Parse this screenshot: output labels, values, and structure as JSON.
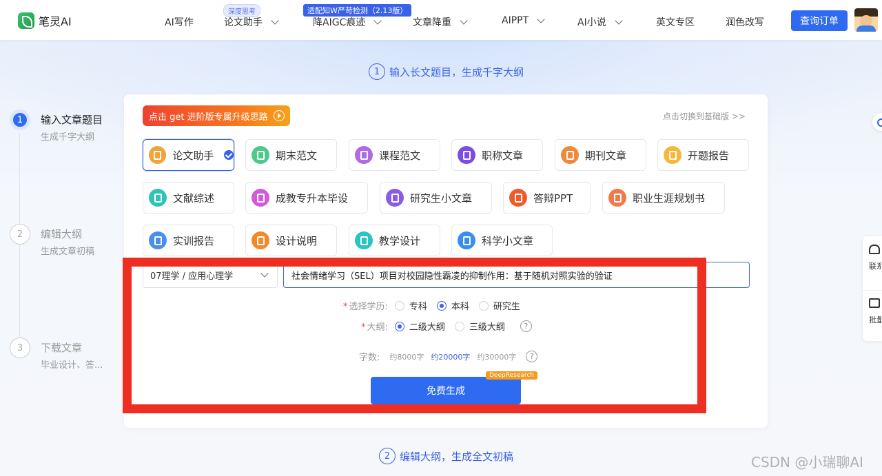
{
  "header": {
    "logo": "笔灵AI",
    "nav": [
      {
        "label": "AI写作",
        "dropdown": false
      },
      {
        "label": "论文助手",
        "dropdown": true,
        "badge": "深度思考"
      },
      {
        "label": "降AIGC痕迹",
        "dropdown": true,
        "badge": "适配知W严苛检测（2.13版）"
      },
      {
        "label": "文章降重",
        "dropdown": true
      },
      {
        "label": "AIPPT",
        "dropdown": true
      },
      {
        "label": "AI小说",
        "dropdown": true
      },
      {
        "label": "英文专区",
        "dropdown": false
      },
      {
        "label": "润色改写",
        "dropdown": false
      }
    ],
    "order_button": "查询订单"
  },
  "steps": [
    {
      "num": "1",
      "title": "输入文章题目",
      "sub": "生成千字大纲",
      "active": true
    },
    {
      "num": "2",
      "title": "编辑大纲",
      "sub": "生成文章初稿",
      "active": false
    },
    {
      "num": "3",
      "title": "下载文章",
      "sub": "毕业设计、答...",
      "active": false
    }
  ],
  "section1": {
    "num": "1",
    "title": "输入长文题目，生成千字大纲"
  },
  "section2": {
    "num": "2",
    "title": "编辑大纲，生成全文初稿"
  },
  "promo": "点击 get 进阶版专属升级思路",
  "switch_link": "点击切换到基础版 >>",
  "doc_types": [
    {
      "label": "论文助手",
      "color": "#f4a23a",
      "selected": true
    },
    {
      "label": "期末范文",
      "color": "#4fc98a",
      "selected": false
    },
    {
      "label": "课程范文",
      "color": "#b06be0",
      "selected": false
    },
    {
      "label": "职称文章",
      "color": "#7b4de0",
      "selected": false
    },
    {
      "label": "期刊文章",
      "color": "#f08a3a",
      "selected": false
    },
    {
      "label": "开题报告",
      "color": "#f5b83d",
      "selected": false
    },
    {
      "label": "文献综述",
      "color": "#2ec4b6",
      "selected": false
    },
    {
      "label": "成教专升本毕设",
      "color": "#d35ad8",
      "selected": false
    },
    {
      "label": "研究生小文章",
      "color": "#8a5ce6",
      "selected": false
    },
    {
      "label": "答辩PPT",
      "color": "#f0592a",
      "selected": false
    },
    {
      "label": "职业生涯规划书",
      "color": "#f07a4a",
      "selected": false
    },
    {
      "label": "实训报告",
      "color": "#4a8ff0",
      "selected": false
    },
    {
      "label": "设计说明",
      "color": "#f28a2a",
      "selected": false
    },
    {
      "label": "教学设计",
      "color": "#2cc3c3",
      "selected": false
    },
    {
      "label": "科学小文章",
      "color": "#3a8ef0",
      "selected": false
    }
  ],
  "form": {
    "major": "07理学 / 应用心理学",
    "topic": "社会情绪学习（SEL）项目对校园隐性霸凌的抑制作用：基于随机对照实验的验证",
    "education_label": "选择学历:",
    "education_options": [
      "专科",
      "本科",
      "研究生"
    ],
    "education_selected": "本科",
    "outline_label": "大纲:",
    "outline_options": [
      "二级大纲",
      "三级大纲"
    ],
    "outline_selected": "二级大纲",
    "wordcount_label": "字数:",
    "wordcount_options": [
      "约8000字",
      "约20000字",
      "约30000字"
    ],
    "wordcount_selected": "约20000字",
    "generate_button": "免费生成",
    "generate_tag": "DeepResearch"
  },
  "side_widget": {
    "contact": "联系客服",
    "bulk": "批量采购"
  },
  "watermark": "CSDN @小瑞聊AI",
  "colors": {
    "accent": "#2f6bf0",
    "highlight_box": "#ee2e21",
    "promo": "#f0412f"
  }
}
